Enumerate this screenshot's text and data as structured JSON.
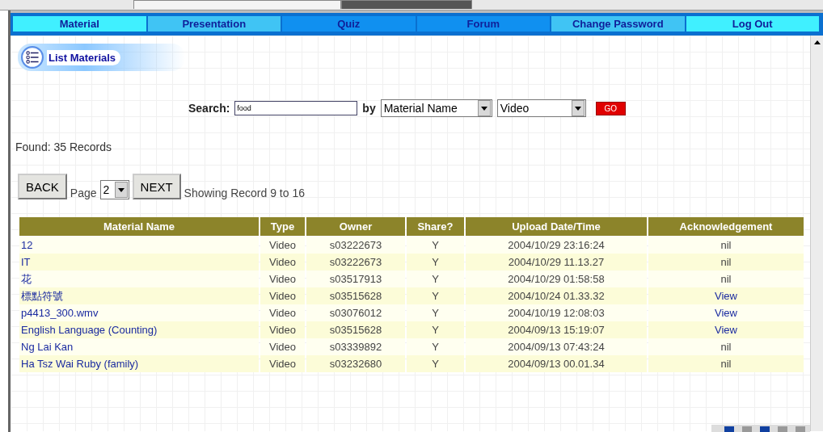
{
  "nav": [
    {
      "label": "Material",
      "color": "#40f0ff"
    },
    {
      "label": "Presentation",
      "color": "#40c4f4"
    },
    {
      "label": "Quiz",
      "color": "#1090f0"
    },
    {
      "label": "Forum",
      "color": "#1090f0"
    },
    {
      "label": "Change Password",
      "color": "#40c4f4"
    },
    {
      "label": "Log Out",
      "color": "#40f0ff"
    }
  ],
  "page_title": "List Materials",
  "search": {
    "label": "Search:",
    "value": "food",
    "by_label": "by",
    "field": "Material Name",
    "type": "Video",
    "go": "GO"
  },
  "found": "Found: 35 Records",
  "pager": {
    "back": "BACK",
    "page_label": "Page",
    "page": "2",
    "next": "NEXT",
    "showing": "Showing Record 9 to 16"
  },
  "table": {
    "columns": [
      "Material Name",
      "Type",
      "Owner",
      "Share?",
      "Upload Date/Time",
      "Acknowledgement"
    ],
    "rows": [
      {
        "name": "12",
        "type": "Video",
        "owner": "s03222673",
        "share": "Y",
        "uploaded": "2004/10/29 23:16:24",
        "ack": {
          "text": "nil",
          "kind": "text"
        }
      },
      {
        "name": "IT",
        "type": "Video",
        "owner": "s03222673",
        "share": "Y",
        "uploaded": "2004/10/29 11.13.27",
        "ack": {
          "text": "nil",
          "kind": "text"
        }
      },
      {
        "name": "花",
        "type": "Video",
        "owner": "s03517913",
        "share": "Y",
        "uploaded": "2004/10/29 01:58:58",
        "ack": {
          "text": "nil",
          "kind": "text"
        }
      },
      {
        "name": "標點符號",
        "type": "Video",
        "owner": "s03515628",
        "share": "Y",
        "uploaded": "2004/10/24 01.33.32",
        "ack": {
          "text": "View",
          "kind": "link"
        }
      },
      {
        "name": "p4413_300.wmv",
        "type": "Video",
        "owner": "s03076012",
        "share": "Y",
        "uploaded": "2004/10/19 12:08:03",
        "ack": {
          "text": "View",
          "kind": "link"
        }
      },
      {
        "name": "English Language (Counting)",
        "type": "Video",
        "owner": "s03515628",
        "share": "Y",
        "uploaded": "2004/09/13 15:19:07",
        "ack": {
          "text": "View",
          "kind": "link"
        }
      },
      {
        "name": "Ng Lai Kan",
        "type": "Video",
        "owner": "s03339892",
        "share": "Y",
        "uploaded": "2004/09/13 07:43:24",
        "ack": {
          "text": "nil",
          "kind": "text"
        }
      },
      {
        "name": "Ha Tsz Wai Ruby (family)",
        "type": "Video",
        "owner": "s03232680",
        "share": "Y",
        "uploaded": "2004/09/13 00.01.34",
        "ack": {
          "text": "nil",
          "kind": "text"
        }
      }
    ]
  }
}
